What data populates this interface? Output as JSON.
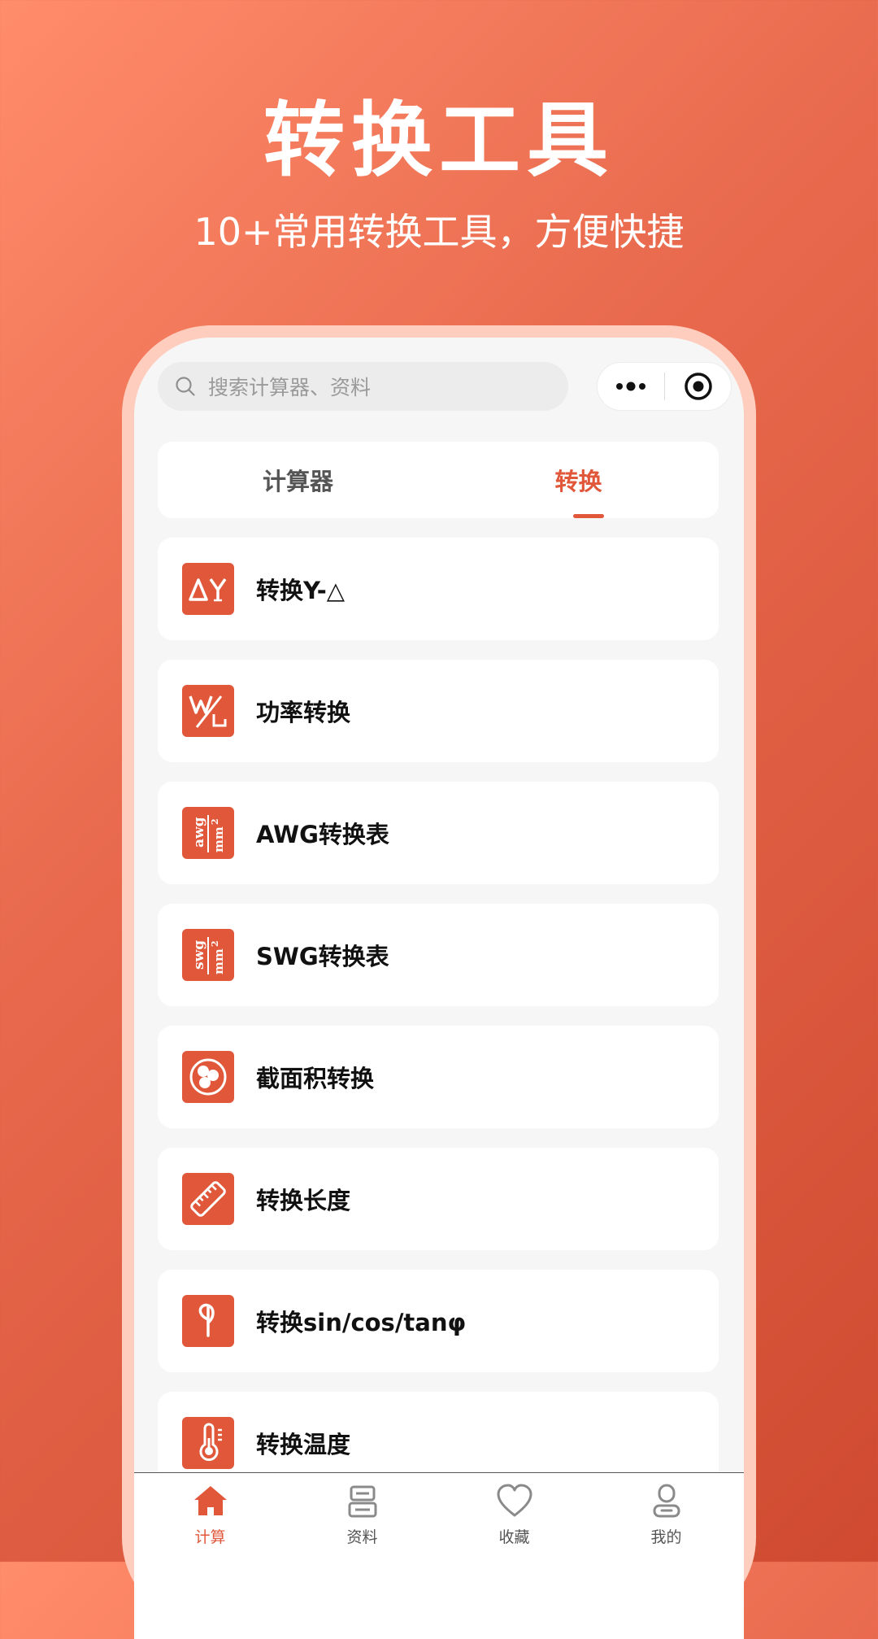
{
  "promo": {
    "title": "转换工具",
    "subtitle": "10+常用转换工具，方便快捷"
  },
  "search": {
    "placeholder": "搜索计算器、资料"
  },
  "capsule": {
    "more_icon": "more-icon",
    "target_icon": "target-icon"
  },
  "tabs": [
    {
      "label": "计算器",
      "active": false
    },
    {
      "label": "转换",
      "active": true
    }
  ],
  "items": [
    {
      "label": "转换Y-△",
      "icon": "delta-y-icon"
    },
    {
      "label": "功率转换",
      "icon": "power-icon"
    },
    {
      "label": "AWG转换表",
      "icon": "awg-icon"
    },
    {
      "label": "SWG转换表",
      "icon": "swg-icon"
    },
    {
      "label": "截面积转换",
      "icon": "cross-section-icon"
    },
    {
      "label": "转换长度",
      "icon": "ruler-icon"
    },
    {
      "label": "转换sin/cos/tanφ",
      "icon": "phi-icon"
    },
    {
      "label": "转换温度",
      "icon": "thermometer-icon"
    }
  ],
  "nav": [
    {
      "label": "计算",
      "icon": "home-icon",
      "active": true
    },
    {
      "label": "资料",
      "icon": "documents-icon",
      "active": false
    },
    {
      "label": "收藏",
      "icon": "heart-icon",
      "active": false
    },
    {
      "label": "我的",
      "icon": "user-icon",
      "active": false
    }
  ],
  "colors": {
    "accent": "#e0573a",
    "frame": "#ffcdbd",
    "background": "#f6f6f6"
  }
}
